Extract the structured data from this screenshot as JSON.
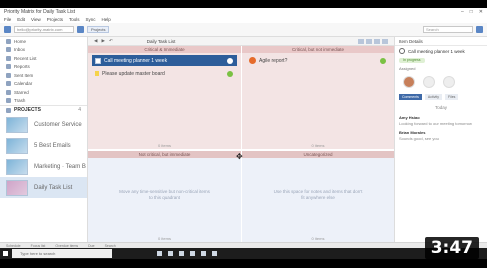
{
  "app": {
    "title": "Priority Matrix for Daily Task List",
    "window_controls": [
      "–",
      "□",
      "✕"
    ]
  },
  "menubar": [
    "File",
    "Edit",
    "View",
    "Projects",
    "Tools",
    "Sync",
    "Help"
  ],
  "toolbar": {
    "email_input": "hello@priority-matrix.com",
    "chip": "Projects",
    "search_placeholder": "Search"
  },
  "leftnav": {
    "items": [
      "Home",
      "Inbox",
      "Recent List",
      "Reports",
      "Sent Item",
      "Calendar",
      "Starred",
      "Trash"
    ],
    "projects_label": "PROJECTS",
    "projects_count": "4",
    "projects": [
      {
        "name": "Customer Service",
        "selected": false
      },
      {
        "name": "5 Best Emails",
        "selected": false
      },
      {
        "name": "Marketing · Team B",
        "selected": false
      },
      {
        "name": "Daily Task List",
        "selected": true
      }
    ]
  },
  "matrix": {
    "title": "Daily Task List",
    "quadrants": [
      {
        "header": "Critical & Immediate",
        "footer": "0 items",
        "tasks": [
          {
            "text": "Call meeting planner 1 week",
            "selected": true
          },
          {
            "text": "Please update master board",
            "selected": false
          }
        ]
      },
      {
        "header": "Critical, but not immediate",
        "footer": "0 items",
        "tasks": [
          {
            "text": "Agile report?",
            "selected": false
          }
        ]
      },
      {
        "header": "Not critical, but immediate",
        "footer": "0 items",
        "empty": "Move any time-sensitive but non-critical items to this quadrant",
        "tasks": []
      },
      {
        "header": "Uncategorized",
        "footer": "0 items",
        "empty": "Use this space for notes and items that don't fit anywhere else",
        "tasks": []
      }
    ]
  },
  "rightpane": {
    "header": "Item Details",
    "task": "Call meeting planner 1 week",
    "status": "In progress",
    "owner_label": "Assigned",
    "tabs": [
      "Comments",
      "Activity",
      "Files"
    ],
    "today_label": "Today",
    "comments": [
      {
        "who": "Amy Hsiao",
        "body": "Looking forward to our meeting tomorrow"
      },
      {
        "who": "Brian Morales",
        "body": "Sounds good, see you"
      }
    ]
  },
  "statusbar": [
    "Schedule",
    "Focus list",
    "Overdue items",
    "Due",
    "Search"
  ],
  "taskbar": {
    "search_placeholder": "Type here to search"
  },
  "video": {
    "timestamp": "3:47"
  }
}
